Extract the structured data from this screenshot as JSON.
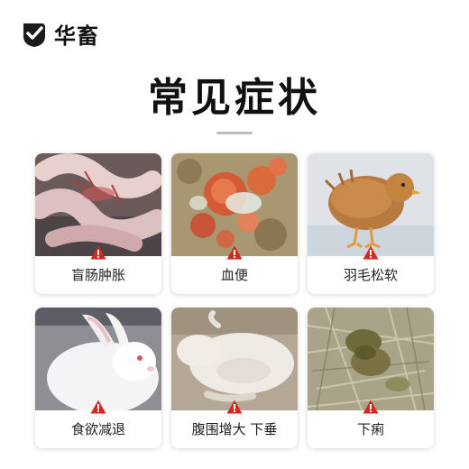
{
  "brand": {
    "name": "华畜",
    "logo_icon": "check-shield-icon"
  },
  "headline": "常见症状",
  "symptoms": [
    {
      "label": "盲肠肿胀",
      "icon": "warning-icon"
    },
    {
      "label": "血便",
      "icon": "warning-icon"
    },
    {
      "label": "羽毛松软",
      "icon": "warning-icon"
    },
    {
      "label": "食欲减退",
      "icon": "warning-icon"
    },
    {
      "label": "腹围增大 下垂",
      "icon": "warning-icon"
    },
    {
      "label": "下痢",
      "icon": "warning-icon"
    }
  ],
  "colors": {
    "warning": "#d9261c",
    "text": "#222222",
    "divider": "#bdbdbd"
  }
}
